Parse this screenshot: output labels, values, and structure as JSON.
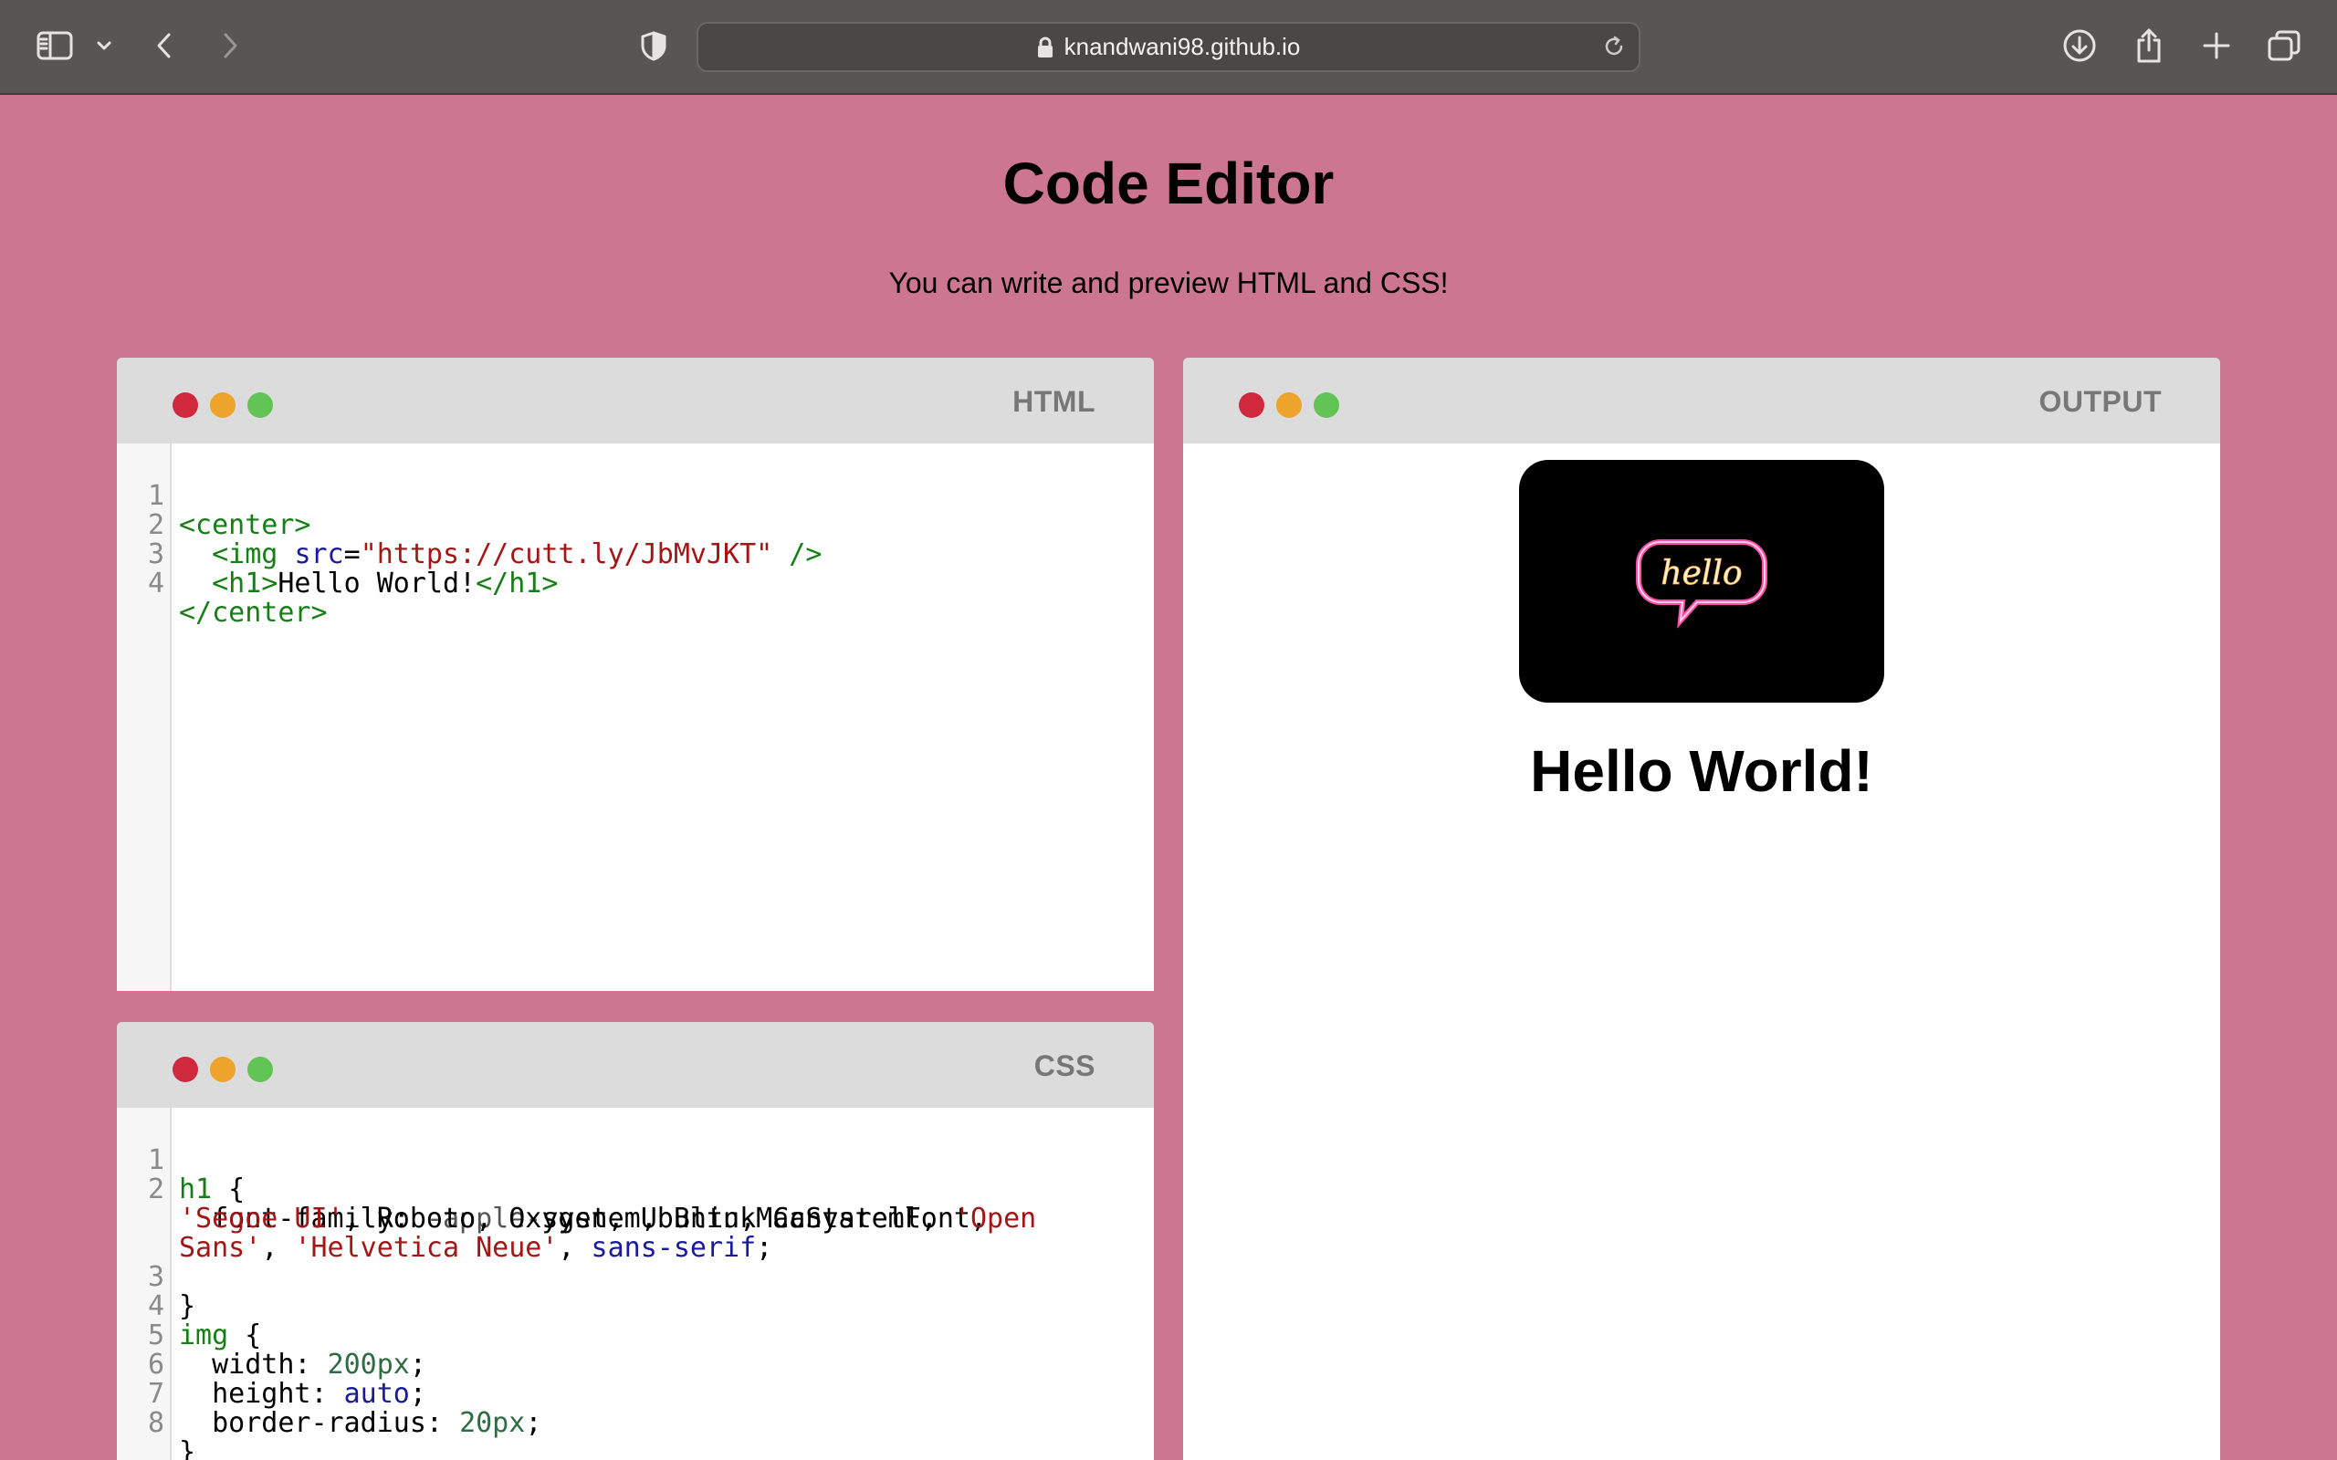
{
  "browser": {
    "url": "knandwani98.github.io"
  },
  "page": {
    "title": "Code Editor",
    "subtitle": "You can write and preview HTML and CSS!"
  },
  "panels": {
    "html": {
      "label": "HTML"
    },
    "css": {
      "label": "CSS"
    },
    "output": {
      "label": "OUTPUT"
    }
  },
  "html_code": {
    "line_numbers": [
      "1",
      "2",
      "3",
      "4"
    ],
    "l1_tag": "<center>",
    "l2_open": "<img ",
    "l2_attr": "src",
    "l2_eq": "=",
    "l2_str": "\"https://cutt.ly/JbMvJKT\"",
    "l2_close": " />",
    "l3_open": "<h1>",
    "l3_text": "Hello World!",
    "l3_close": "</h1>",
    "l4_tag": "</center>"
  },
  "css_code": {
    "line_numbers": [
      "1",
      "2",
      "3",
      "4",
      "5",
      "6",
      "7",
      "8"
    ],
    "l1_sel": "h1",
    "l1_rest": " {",
    "l2a_prop": "font-family: ",
    "l2a_grey": "-apple-",
    "l2a_rest": "system, BlinkMacSystemFont,",
    "l2b_str1": "'Segoe UI'",
    "l2b_mid": ", Roboto, Oxygen, Ubuntu, Cantarell, ",
    "l2b_str2": "'Open",
    "l2c_str1": "Sans'",
    "l2c_mid": ", ",
    "l2c_str2": "'Helvetica Neue'",
    "l2c_mid2": ", ",
    "l2c_kw": "sans-serif",
    "l2c_end": ";",
    "l3": "}",
    "l4_sel": "img",
    "l4_rest": " {",
    "l5_prop": "width: ",
    "l5_val": "200px",
    "l5_end": ";",
    "l6_prop": "height: ",
    "l6_val": "auto",
    "l6_end": ";",
    "l7_prop": "border-radius: ",
    "l7_val": "20px",
    "l7_end": ";",
    "l8": "}"
  },
  "output": {
    "image_text": "hello",
    "heading": "Hello World!"
  },
  "colors": {
    "page_background": "#cd7690",
    "toolbar": "#585553",
    "dot_red": "#d0283c",
    "dot_yellow": "#eda42c",
    "dot_green": "#61c454"
  },
  "icons": [
    "sidebar-icon",
    "chevron-down-icon",
    "back-icon",
    "forward-icon",
    "privacy-shield-icon",
    "lock-icon",
    "reload-icon",
    "download-icon",
    "share-icon",
    "new-tab-icon",
    "tab-overview-icon"
  ]
}
